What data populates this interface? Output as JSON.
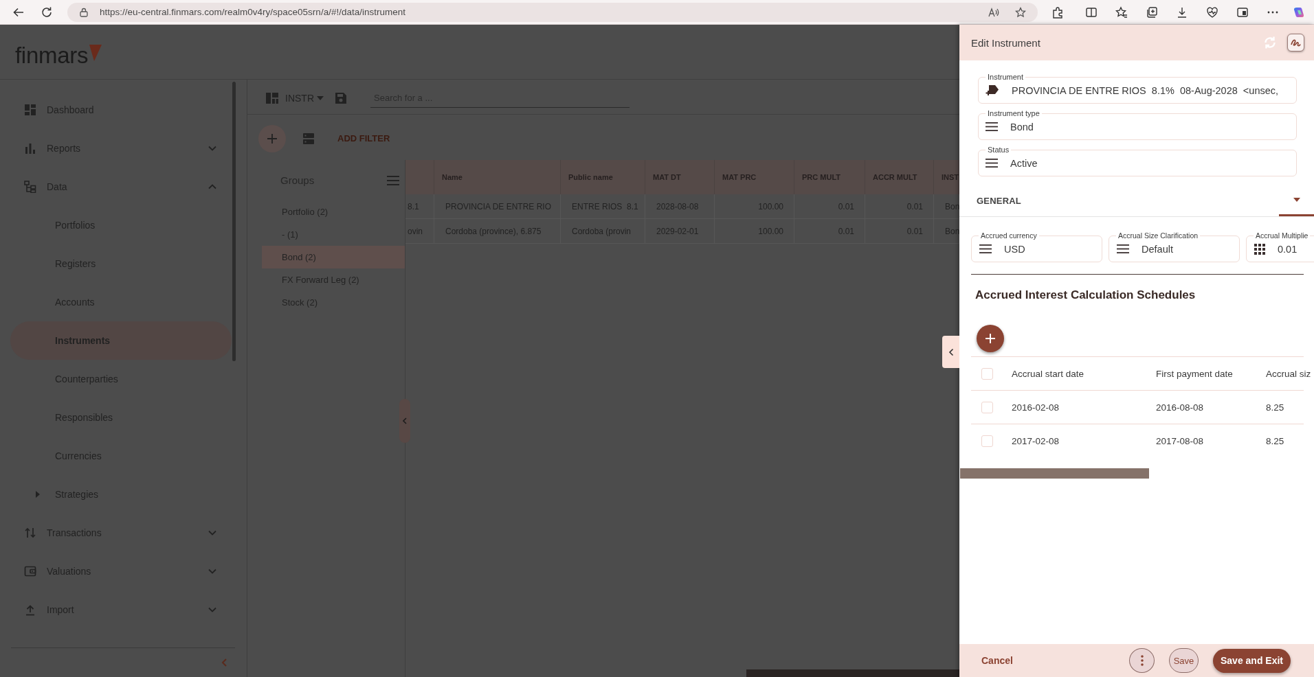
{
  "browser": {
    "url": "https://eu-central.finmars.com/realm0v4ry/space05srn/a/#!/data/instrument"
  },
  "app": {
    "logo": "finmars"
  },
  "sidebar": {
    "items": [
      {
        "label": "Dashboard",
        "kind": "link",
        "selected": false
      },
      {
        "label": "Reports",
        "kind": "group",
        "expanded": false,
        "selected": false
      },
      {
        "label": "Data",
        "kind": "group",
        "expanded": true,
        "selected": false,
        "children": [
          {
            "label": "Portfolios",
            "kind": "link",
            "selected": false
          },
          {
            "label": "Registers",
            "kind": "link",
            "selected": false
          },
          {
            "label": "Accounts",
            "kind": "link",
            "selected": false
          },
          {
            "label": "Instruments",
            "kind": "link",
            "selected": true
          },
          {
            "label": "Counterparties",
            "kind": "link",
            "selected": false
          },
          {
            "label": "Responsibles",
            "kind": "link",
            "selected": false
          },
          {
            "label": "Currencies",
            "kind": "link",
            "selected": false
          },
          {
            "label": "Strategies",
            "kind": "group",
            "expanded": false,
            "selected": false
          }
        ]
      },
      {
        "label": "Transactions",
        "kind": "group",
        "expanded": false,
        "selected": false
      },
      {
        "label": "Valuations",
        "kind": "group",
        "expanded": false,
        "selected": false
      },
      {
        "label": "Import",
        "kind": "group",
        "expanded": false,
        "selected": false
      }
    ]
  },
  "main": {
    "layout": "INSTR",
    "search": {
      "placeholder": "Search for a ..."
    },
    "add_filter": "ADD FILTER",
    "groups": {
      "title": "Groups",
      "items": [
        {
          "label": "Portfolio (2)",
          "selected": false
        },
        {
          "label": "- (1)",
          "selected": false
        },
        {
          "label": "Bond (2)",
          "selected": true
        },
        {
          "label": "FX Forward Leg (2)",
          "selected": false
        },
        {
          "label": "Stock (2)",
          "selected": false
        }
      ]
    },
    "table": {
      "columns": [
        {
          "kind": "text"
        },
        {
          "label": "Name",
          "kind": "text"
        },
        {
          "label": "Public name",
          "kind": "text"
        },
        {
          "label": "MAT DT",
          "kind": "text"
        },
        {
          "label": "MAT PRC",
          "kind": "number"
        },
        {
          "label": "PRC MULT",
          "kind": "number"
        },
        {
          "label": "ACCR MULT",
          "kind": "number"
        },
        {
          "label": "INST",
          "kind": "text"
        }
      ],
      "rows": [
        {
          "cells": [
            "8.1",
            "PROVINCIA DE ENTRE RIO",
            "ENTRE RIOS  8.1",
            "2028-08-08",
            "100.00",
            "0.01",
            "0.01",
            "Bon"
          ]
        },
        {
          "cells": [
            "ovin",
            "Cordoba (province), 6.875",
            "Cordoba (provin",
            "2029-02-01",
            "100.00",
            "0.01",
            "0.01",
            "Bon"
          ]
        }
      ]
    }
  },
  "edit_panel": {
    "title": "Edit Instrument",
    "fields": [
      {
        "label": "Instrument",
        "value": "PROVINCIA DE ENTRE RIOS  8.1%  08-Aug-2028  <unsec,",
        "kind": "instrument"
      },
      {
        "label": "Instrument type",
        "value": "Bond",
        "kind": "select"
      },
      {
        "label": "Status",
        "value": "Active",
        "kind": "select"
      }
    ],
    "section": {
      "label": "GENERAL"
    },
    "general_fields": [
      {
        "label": "Accrued currency",
        "value": "USD",
        "kind": "select"
      },
      {
        "label": "Accrual Size Clarification",
        "value": "Default",
        "kind": "select"
      },
      {
        "label": "Accrual Multiplie",
        "value": "0.01",
        "kind": "number"
      }
    ],
    "schedules": {
      "title": "Accrued Interest Calculation Schedules",
      "select_all": {
        "checked": false
      },
      "columns": [
        "Accrual start date",
        "First payment date",
        "Accrual siz"
      ],
      "rows": [
        {
          "checked": false,
          "cells": [
            "2016-02-08",
            "2016-08-08",
            "8.25"
          ]
        },
        {
          "checked": false,
          "cells": [
            "2017-02-08",
            "2017-08-08",
            "8.25"
          ]
        }
      ]
    },
    "actions": [
      {
        "kind": "text",
        "label": "Cancel"
      },
      {
        "kind": "icon"
      },
      {
        "kind": "outlined",
        "label": "Save"
      },
      {
        "kind": "primary",
        "label": "Save and Exit"
      }
    ]
  }
}
